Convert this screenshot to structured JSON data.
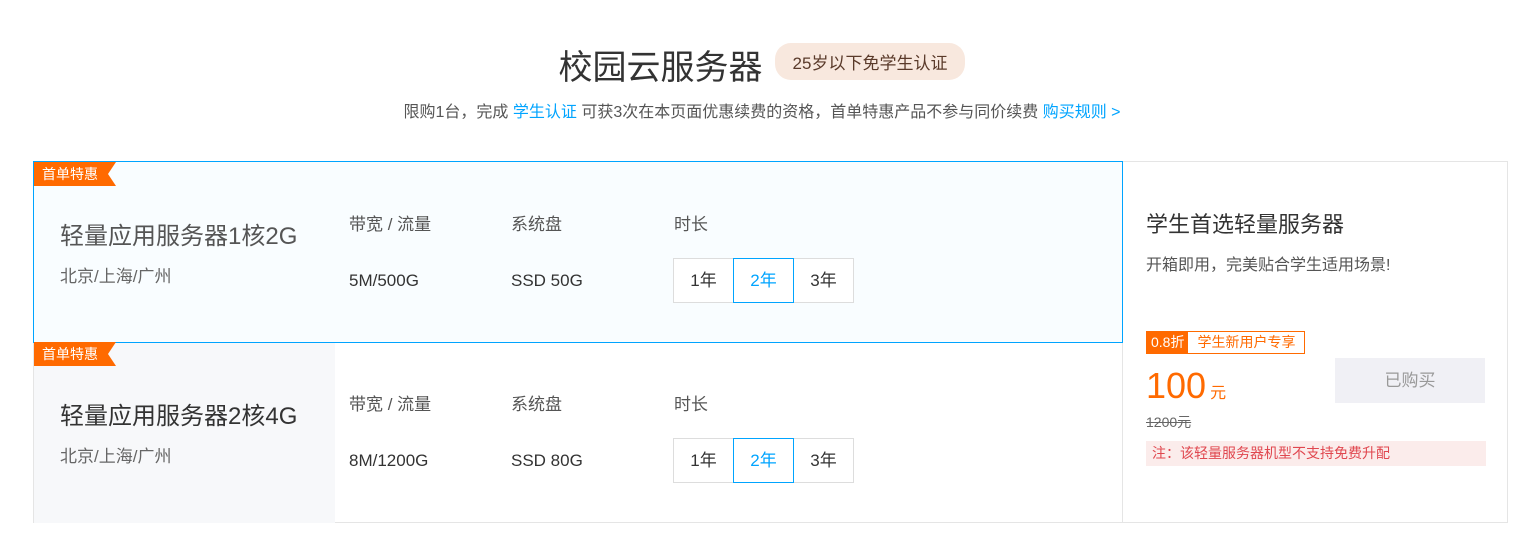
{
  "header": {
    "title": "校园云服务器",
    "badge": "25岁以下免学生认证",
    "sub_prefix": "限购1台，完成 ",
    "sub_link": "学生认证",
    "sub_mid": " 可获3次在本页面优惠续费的资格，首单特惠产品不参与同价续费 ",
    "rules_link": "购买规则 >"
  },
  "labels": {
    "bandwidth": "带宽 / 流量",
    "disk": "系统盘",
    "duration": "时长"
  },
  "products": [
    {
      "tag": "首单特惠",
      "name": "轻量应用服务器1核2G",
      "regions": "北京/上海/广州",
      "bandwidth": "5M/500G",
      "disk": "SSD 50G",
      "durations": [
        "1年",
        "2年",
        "3年"
      ],
      "selected": "2年"
    },
    {
      "tag": "首单特惠",
      "name": "轻量应用服务器2核4G",
      "regions": "北京/上海/广州",
      "bandwidth": "8M/1200G",
      "disk": "SSD 80G",
      "durations": [
        "1年",
        "2年",
        "3年"
      ],
      "selected": "2年"
    }
  ],
  "side": {
    "title": "学生首选轻量服务器",
    "desc": "开箱即用，完美贴合学生适用场景!",
    "discount": "0.8折",
    "discount_label": "学生新用户专享",
    "price": "100",
    "price_unit": "元",
    "original_price": "1200元",
    "buy_button": "已购买",
    "note": "注：该轻量服务器机型不支持免费升配"
  },
  "colors": {
    "accent": "#00a4ff",
    "orange": "#ff6a00"
  }
}
